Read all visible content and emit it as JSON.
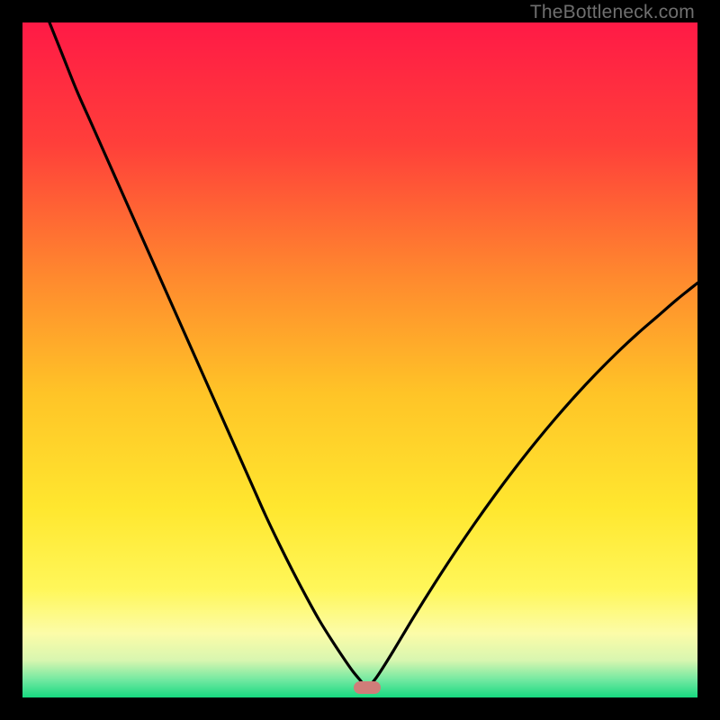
{
  "watermark": "TheBottleneck.com",
  "colors": {
    "frame": "#000000",
    "marker": "#cf7d79",
    "curve": "#000000",
    "gradient_stops": [
      {
        "pos": 0.0,
        "color": "#ff1a46"
      },
      {
        "pos": 0.18,
        "color": "#ff3f3a"
      },
      {
        "pos": 0.38,
        "color": "#ff8a2e"
      },
      {
        "pos": 0.55,
        "color": "#ffc427"
      },
      {
        "pos": 0.72,
        "color": "#ffe72f"
      },
      {
        "pos": 0.84,
        "color": "#fff75a"
      },
      {
        "pos": 0.905,
        "color": "#fcfca8"
      },
      {
        "pos": 0.945,
        "color": "#d8f6b0"
      },
      {
        "pos": 0.975,
        "color": "#6ee8a0"
      },
      {
        "pos": 1.0,
        "color": "#17d980"
      }
    ]
  },
  "chart_data": {
    "type": "line",
    "title": "",
    "xlabel": "",
    "ylabel": "",
    "xlim": [
      0,
      100
    ],
    "ylim": [
      0,
      100
    ],
    "notch_x": 51,
    "marker": {
      "x": 51,
      "y": 1.5
    },
    "series": [
      {
        "name": "bottleneck-curve",
        "x": [
          4,
          6,
          8,
          10,
          12,
          14,
          16,
          18,
          20,
          22,
          24,
          26,
          28,
          30,
          32,
          34,
          36,
          38,
          40,
          42,
          44,
          46,
          48,
          49,
          50,
          51,
          52,
          53,
          55,
          58,
          61,
          64,
          67,
          70,
          73,
          76,
          79,
          82,
          85,
          88,
          91,
          94,
          97,
          100
        ],
        "y": [
          100,
          95,
          90,
          85.5,
          81,
          76.5,
          72,
          67.5,
          63,
          58.5,
          54,
          49.5,
          45,
          40.5,
          36,
          31.5,
          27,
          22.8,
          18.8,
          15,
          11.4,
          8.2,
          5.2,
          3.8,
          2.6,
          1.5,
          2.4,
          3.8,
          7.0,
          12.0,
          16.8,
          21.4,
          25.8,
          30.0,
          34.0,
          37.8,
          41.4,
          44.8,
          48.0,
          51.0,
          53.8,
          56.4,
          59.0,
          61.4
        ]
      }
    ]
  }
}
